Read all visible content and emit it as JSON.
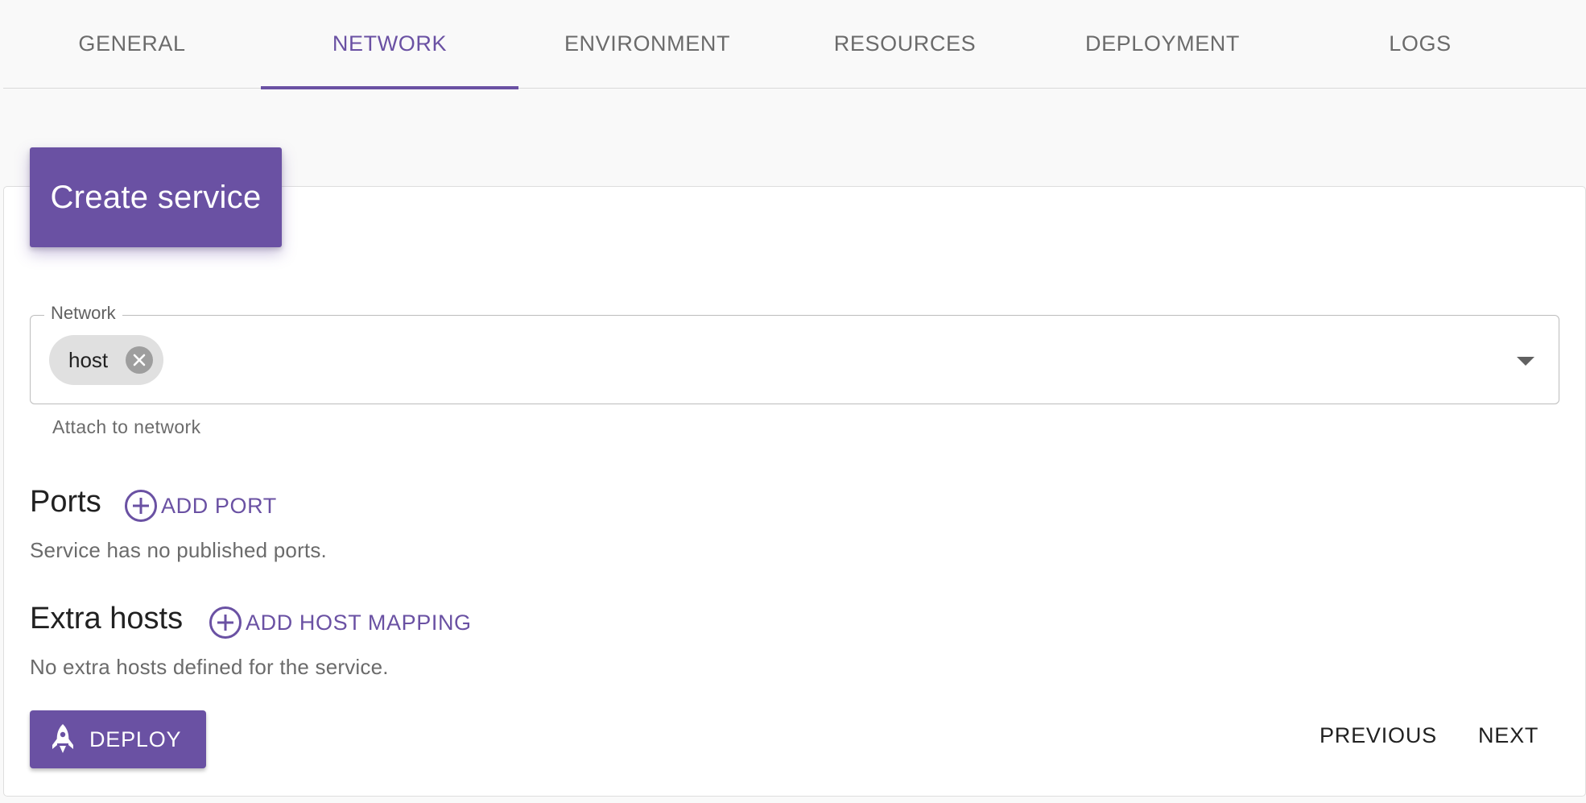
{
  "tabs": [
    {
      "label": "GENERAL"
    },
    {
      "label": "NETWORK"
    },
    {
      "label": "ENVIRONMENT"
    },
    {
      "label": "RESOURCES"
    },
    {
      "label": "DEPLOYMENT"
    },
    {
      "label": "LOGS"
    }
  ],
  "active_tab": "NETWORK",
  "card": {
    "title": "Create service"
  },
  "network": {
    "label": "Network",
    "chips": [
      {
        "label": "host"
      }
    ],
    "helper": "Attach to network"
  },
  "ports": {
    "title": "Ports",
    "add_label": "ADD PORT",
    "empty_text": "Service has no published ports."
  },
  "extra_hosts": {
    "title": "Extra hosts",
    "add_label": "ADD HOST MAPPING",
    "empty_text": "No extra hosts defined for the service."
  },
  "actions": {
    "deploy_label": "DEPLOY",
    "previous_label": "PREVIOUS",
    "next_label": "NEXT"
  },
  "colors": {
    "accent": "#6a51a3",
    "background": "#f9f9f9",
    "chip_background": "#e0e0e0"
  },
  "icons": {
    "chip_remove": "close-circle-icon",
    "add": "plus-circle-icon",
    "deploy": "rocket-icon",
    "dropdown": "arrow-drop-down-icon"
  }
}
